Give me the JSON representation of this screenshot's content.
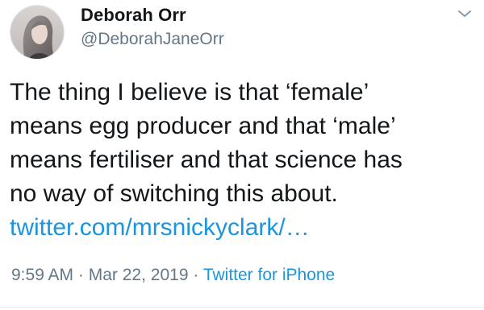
{
  "author": {
    "display_name": "Deborah Orr",
    "handle": "@DeborahJaneOrr",
    "avatar_icon": "profile-photo"
  },
  "tweet": {
    "lines": [
      "The thing I believe is that ‘female’",
      "means egg producer and that ‘male’",
      "means fertiliser and that science has",
      "no way of switching this about."
    ],
    "link": "twitter.com/mrsnickyclark/…"
  },
  "meta": {
    "time": "9:59 AM",
    "separator": "·",
    "date": "Mar 22, 2019",
    "source": "Twitter for iPhone"
  },
  "colors": {
    "link": "#1b95e0",
    "text": "#14171a",
    "secondary": "#657786"
  },
  "icons": {
    "menu": "chevron-down-icon"
  }
}
